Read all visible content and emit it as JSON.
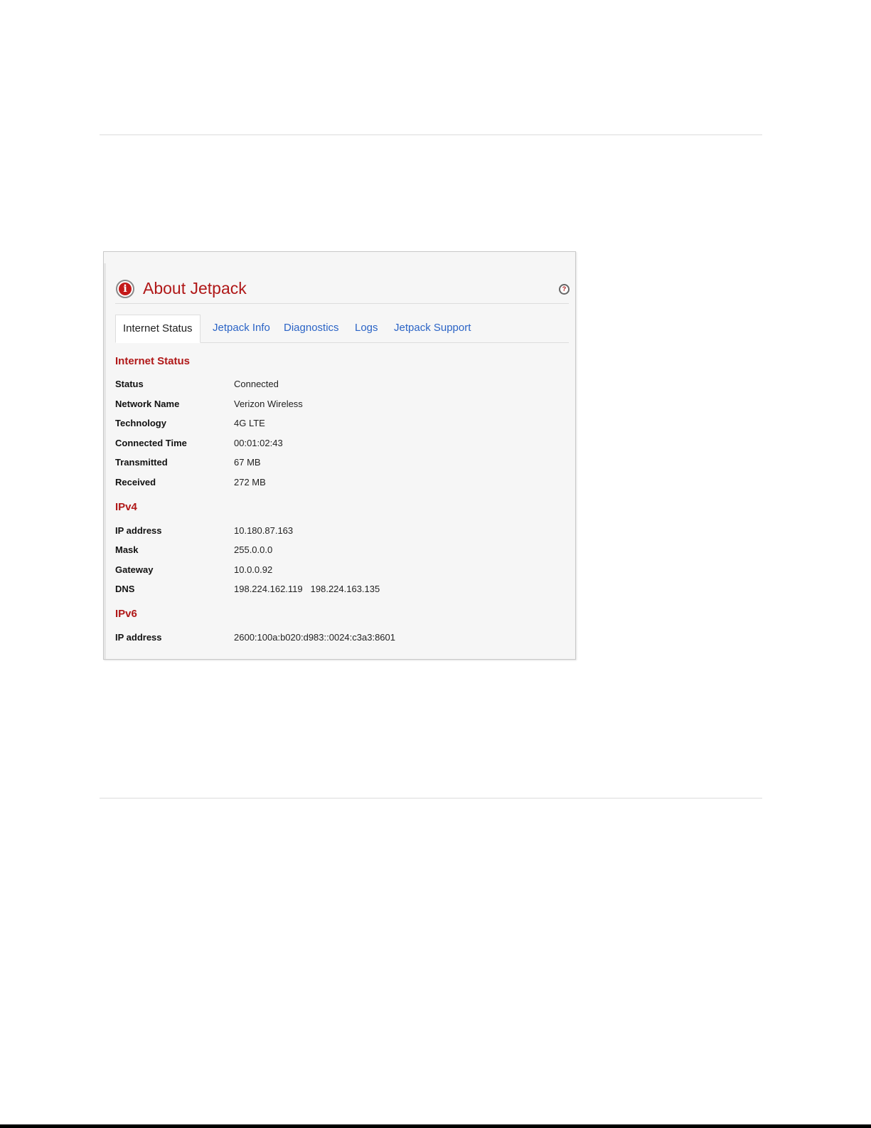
{
  "panel": {
    "title": "About Jetpack",
    "icons": {
      "info": "info-icon",
      "help": "help-icon",
      "info_glyph": "i",
      "help_glyph": "?"
    },
    "tabs": [
      {
        "label": "Internet Status",
        "active": true
      },
      {
        "label": "Jetpack Info",
        "active": false
      },
      {
        "label": "Diagnostics",
        "active": false
      },
      {
        "label": "Logs",
        "active": false
      },
      {
        "label": "Jetpack Support",
        "active": false
      }
    ]
  },
  "internet_status": {
    "heading": "Internet Status",
    "rows": [
      {
        "label": "Status",
        "value": "Connected"
      },
      {
        "label": "Network Name",
        "value": "Verizon Wireless"
      },
      {
        "label": "Technology",
        "value": "4G LTE"
      },
      {
        "label": "Connected Time",
        "value": "00:01:02:43"
      },
      {
        "label": "Transmitted",
        "value": "67 MB"
      },
      {
        "label": "Received",
        "value": "272 MB"
      }
    ]
  },
  "ipv4": {
    "heading": "IPv4",
    "rows": [
      {
        "label": "IP address",
        "value": "10.180.87.163"
      },
      {
        "label": "Mask",
        "value": "255.0.0.0"
      },
      {
        "label": "Gateway",
        "value": "10.0.0.92"
      },
      {
        "label": "DNS",
        "value": "198.224.162.119",
        "value2": "198.224.163.135"
      }
    ]
  },
  "ipv6": {
    "heading": "IPv6",
    "rows": [
      {
        "label": "IP address",
        "value": "2600:100a:b020:d983::0024:c3a3:8601"
      }
    ]
  },
  "colors": {
    "accent_red": "#b01818",
    "link_blue": "#2b64c6",
    "panel_bg": "#f6f6f6"
  }
}
